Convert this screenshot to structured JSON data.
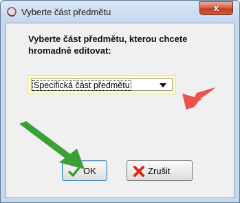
{
  "window": {
    "title": "Vyberte část předmětu",
    "close_label": "x"
  },
  "dialog": {
    "prompt": "Vyberte část předmětu, kterou chcete hromadně editovat:",
    "select": {
      "value": "Specifická část předmětu"
    },
    "buttons": {
      "ok_label": "OK",
      "cancel_label": "Zrušit"
    }
  },
  "icons": {
    "app": "app-ring-icon",
    "ok": "checkmark-icon",
    "cancel": "red-x-icon",
    "dropdown": "chevron-down-icon"
  },
  "colors": {
    "arrow_red": "#f0504b",
    "arrow_green": "#3aa136",
    "select_highlight": "#fdfbc0",
    "close_button": "#c9452a"
  }
}
